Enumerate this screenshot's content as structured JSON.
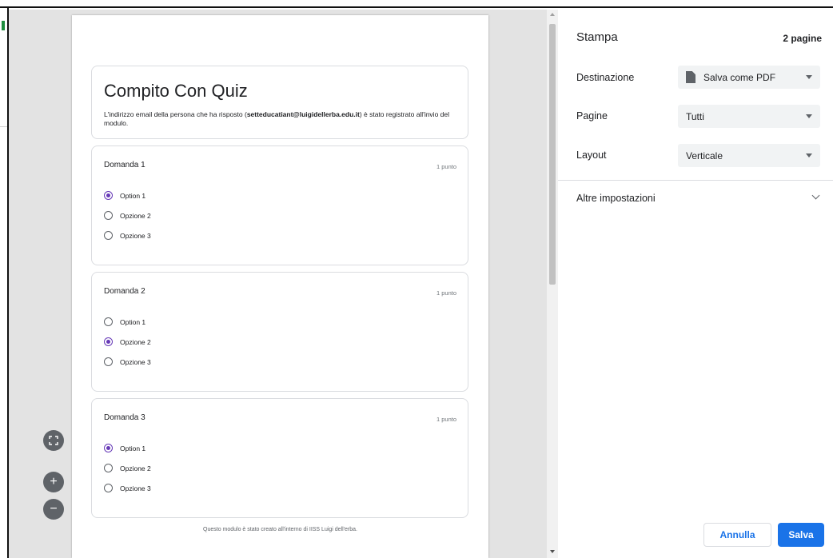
{
  "preview": {
    "form_title": "Compito Con Quiz",
    "desc_prefix": "L'indirizzo email della persona che ha risposto (",
    "desc_email": "setteducatiant@luigidellerba.edu.it",
    "desc_suffix": ") è stato registrato all'invio del modulo.",
    "questions": [
      {
        "title": "Domanda 1",
        "points": "1 punto",
        "options": [
          {
            "label": "Option 1",
            "selected": true
          },
          {
            "label": "Opzione 2",
            "selected": false
          },
          {
            "label": "Opzione 3",
            "selected": false
          }
        ]
      },
      {
        "title": "Domanda 2",
        "points": "1 punto",
        "options": [
          {
            "label": "Option 1",
            "selected": false
          },
          {
            "label": "Opzione 2",
            "selected": true
          },
          {
            "label": "Opzione 3",
            "selected": false
          }
        ]
      },
      {
        "title": "Domanda 3",
        "points": "1 punto",
        "options": [
          {
            "label": "Option 1",
            "selected": true
          },
          {
            "label": "Opzione 2",
            "selected": false
          },
          {
            "label": "Opzione 3",
            "selected": false
          }
        ]
      }
    ],
    "footer": "Questo modulo è stato creato all'interno di IISS Luigi dell'erba."
  },
  "zoom": {
    "fit_icon": "fit-to-page-icon",
    "in_icon": "zoom-in-icon",
    "in_glyph": "+",
    "out_icon": "zoom-out-icon",
    "out_glyph": "−"
  },
  "settings": {
    "title": "Stampa",
    "page_count": "2 pagine",
    "destination_label": "Destinazione",
    "destination_value": "Salva come PDF",
    "destination_icon": "document-icon",
    "pages_label": "Pagine",
    "pages_value": "Tutti",
    "layout_label": "Layout",
    "layout_value": "Verticale",
    "more_settings": "Altre impostazioni",
    "cancel_button": "Annulla",
    "save_button": "Salva"
  },
  "colors": {
    "accent": "#1a73e8",
    "radio_selected": "#673ab7",
    "preview_bg": "#e3e3e3"
  }
}
